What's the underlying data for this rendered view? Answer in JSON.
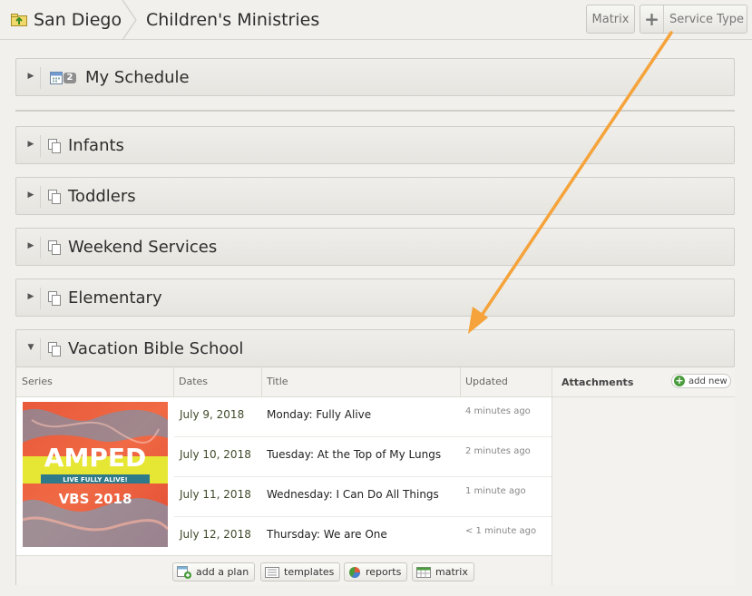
{
  "breadcrumb": {
    "home": "San Diego",
    "current": "Children's Ministries"
  },
  "toolbar": {
    "matrix": "Matrix",
    "service_type": "Service Type"
  },
  "my_schedule": {
    "title": "My Schedule",
    "badge": "2"
  },
  "panels": [
    {
      "title": "Infants"
    },
    {
      "title": "Toddlers"
    },
    {
      "title": "Weekend Services"
    },
    {
      "title": "Elementary"
    },
    {
      "title": "Vacation Bible School"
    }
  ],
  "table": {
    "headers": {
      "series": "Series",
      "dates": "Dates",
      "title": "Title",
      "updated": "Updated"
    },
    "series_art": {
      "line1": "AMPED",
      "line2": "LIVE FULLY ALIVE!",
      "line3": "VBS 2018"
    },
    "rows": [
      {
        "date": "July 9, 2018",
        "title": "Monday: Fully Alive",
        "updated": "4 minutes ago"
      },
      {
        "date": "July 10, 2018",
        "title": "Tuesday: At the Top of My Lungs",
        "updated": "2 minutes ago"
      },
      {
        "date": "July 11, 2018",
        "title": "Wednesday: I Can Do All Things",
        "updated": "1 minute ago"
      },
      {
        "date": "July 12, 2018",
        "title": "Thursday: We are One",
        "updated": "< 1 minute ago"
      }
    ]
  },
  "footer": {
    "add_plan": "add a plan",
    "templates": "templates",
    "reports": "reports",
    "matrix": "matrix"
  },
  "attachments": {
    "label": "Attachments",
    "add_new": "add new"
  },
  "colors": {
    "arrow": "#f5a33a",
    "date_text": "#3e4a2a",
    "add_green": "#4a9c3c"
  }
}
